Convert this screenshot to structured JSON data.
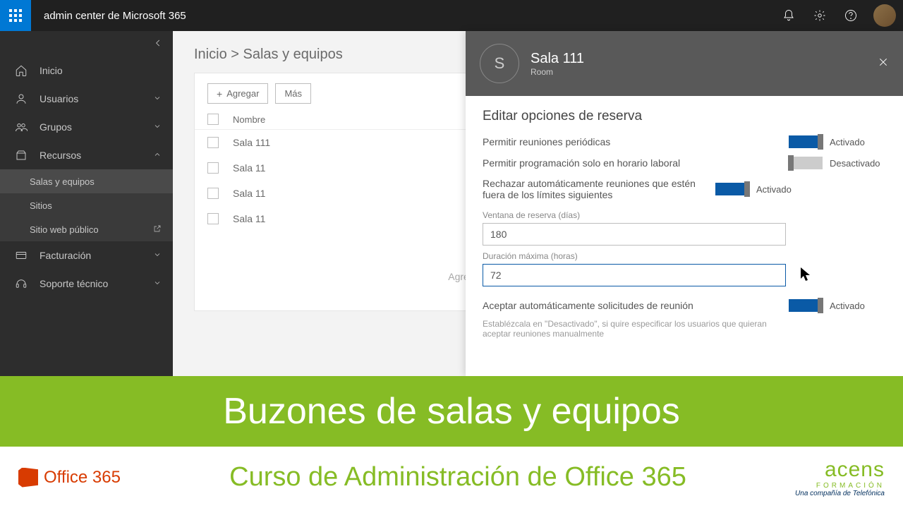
{
  "topbar": {
    "title": "admin center de Microsoft 365"
  },
  "sidebar": {
    "items": [
      "Inicio",
      "Usuarios",
      "Grupos",
      "Recursos",
      "Facturación",
      "Soporte técnico"
    ],
    "sub": [
      "Salas y equipos",
      "Sitios",
      "Sitio web público"
    ]
  },
  "breadcrumb": {
    "home": "Inicio",
    "sep": ">",
    "current": "Salas y equipos"
  },
  "toolbar": {
    "add": "Agregar",
    "more": "Más"
  },
  "table": {
    "header_name": "Nombre",
    "rows": [
      "Sala 111",
      "Sala 11",
      "Sala 11",
      "Sala 11"
    ],
    "empty": "Agregue una sala o equipo para reservar"
  },
  "panel": {
    "initial": "S",
    "title": "Sala 111",
    "subtitle": "Room",
    "heading": "Editar opciones de reserva",
    "opt1": "Permitir reuniones periódicas",
    "opt2": "Permitir programación solo en horario laboral",
    "opt3": "Rechazar automáticamente reuniones que estén fuera de los límites siguientes",
    "opt4": "Aceptar automáticamente solicitudes de reunión",
    "on": "Activado",
    "off": "Desactivado",
    "field1_label": "Ventana de reserva (días)",
    "field1_value": "180",
    "field2_label": "Duración máxima (horas)",
    "field2_value": "72",
    "hint": "Establézcala en \"Desactivado\", si quire especificar los usuarios que quieran aceptar reuniones manualmente"
  },
  "banner": {
    "top": "Buzones de salas y equipos",
    "office": "Office 365",
    "course": "Curso de Administración de Office 365",
    "brand": "acens",
    "brand_sub1": "FORMACIÓN",
    "brand_sub2": "Una compañía de Telefónica"
  }
}
